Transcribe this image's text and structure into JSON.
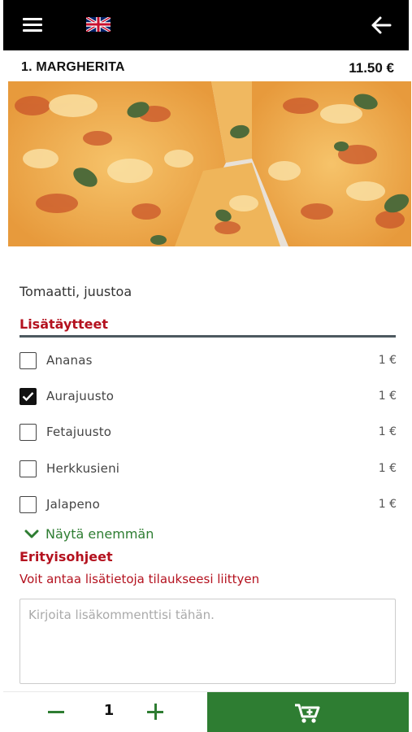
{
  "header": {
    "menu_icon": "hamburger-menu-icon",
    "language_icon": "uk-flag-icon",
    "back_icon": "arrow-left-icon"
  },
  "product": {
    "title": "1. MARGHERITA",
    "price": "11.50 €",
    "image_icon": "margherita-pizza-photo",
    "description": "Tomaatti, juustoa"
  },
  "extras": {
    "heading": "Lisätäytteet",
    "items": [
      {
        "name": "Ananas",
        "price": "1 €",
        "checked": false
      },
      {
        "name": "Aurajuusto",
        "price": "1 €",
        "checked": true
      },
      {
        "name": "Fetajuusto",
        "price": "1 €",
        "checked": false
      },
      {
        "name": "Herkkusieni",
        "price": "1 €",
        "checked": false
      },
      {
        "name": "Jalapeno",
        "price": "1 €",
        "checked": false
      }
    ],
    "show_more": "Näytä enemmän"
  },
  "special": {
    "heading": "Erityisohjeet",
    "subtitle": "Voit antaa lisätietoja tilaukseesi liittyen",
    "placeholder": "Kirjoita lisäkommenttisi tähän."
  },
  "footer": {
    "quantity": "1",
    "cart_icon": "add-to-cart-icon"
  },
  "colors": {
    "topbar": "#000000",
    "accent_red": "#b4121f",
    "accent_green": "#2e7d32"
  }
}
